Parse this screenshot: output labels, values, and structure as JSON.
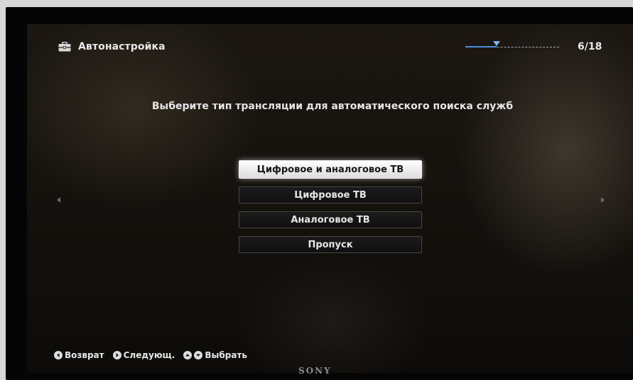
{
  "header": {
    "title": "Автонастройка",
    "icon": "toolbox-icon",
    "progress_text": "6/18",
    "progress_fraction": 0.33
  },
  "prompt": "Выберите тип трансляции для автоматического поиска служб",
  "options": [
    {
      "label": "Цифровое и аналоговое ТВ",
      "selected": true
    },
    {
      "label": "Цифровое ТВ",
      "selected": false
    },
    {
      "label": "Аналоговое ТВ",
      "selected": false
    },
    {
      "label": "Пропуск",
      "selected": false
    }
  ],
  "footer": {
    "back_label": "Возврат",
    "next_label": "Следующ.",
    "select_label": "Выбрать"
  },
  "brand": "SONY",
  "colors": {
    "accent": "#4a8dd8",
    "text": "#e6e6e6",
    "selected_bg": "#ffffff"
  }
}
